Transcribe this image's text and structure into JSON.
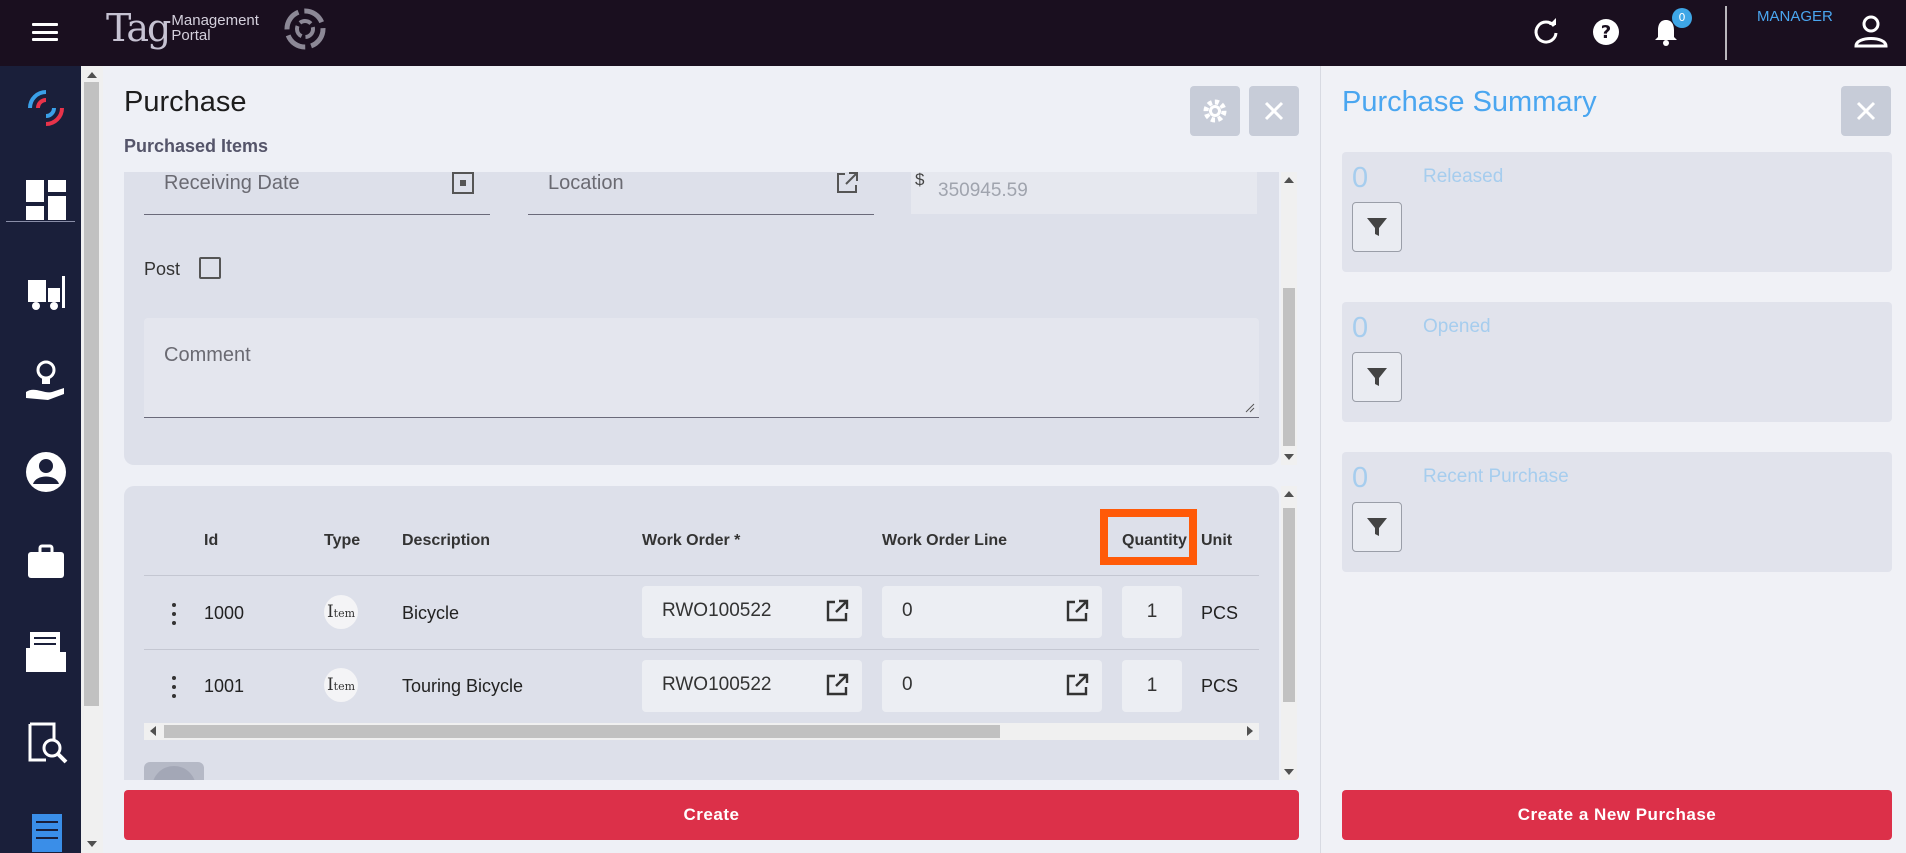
{
  "header": {
    "logo_main": "Tag",
    "logo_line1": "Management",
    "logo_line2": "Portal",
    "notifications_count": "0",
    "role": "MANAGER",
    "icons": [
      "menu-icon",
      "refresh-icon",
      "help-icon",
      "bell-icon",
      "user-icon"
    ]
  },
  "sidebar": {
    "items": [
      {
        "icon": "logo-mark-icon"
      },
      {
        "icon": "dashboard-icon"
      },
      {
        "icon": "forklift-icon"
      },
      {
        "icon": "ideas-icon"
      },
      {
        "icon": "account-icon"
      },
      {
        "icon": "briefcase-icon"
      },
      {
        "icon": "folder-icon"
      },
      {
        "icon": "inspect-icon"
      },
      {
        "icon": "receipt-icon"
      }
    ]
  },
  "main": {
    "title": "Purchase",
    "subtitle": "Purchased Items",
    "form": {
      "receiving_date_label": "Receiving Date",
      "location_label": "Location",
      "currency_symbol": "$",
      "amount": "350945.59",
      "post_label": "Post",
      "post_checked": false,
      "comment_placeholder": "Comment"
    },
    "table": {
      "columns": [
        "Id",
        "Type",
        "Description",
        "Work Order *",
        "Work Order Line",
        "Quantity",
        "Unit"
      ],
      "rows": [
        {
          "id": "1000",
          "type_cap": "I",
          "type_rest": "tem",
          "description": "Bicycle",
          "work_order": "RWO100522",
          "work_order_line": "0",
          "quantity": "1",
          "unit": "PCS"
        },
        {
          "id": "1001",
          "type_cap": "I",
          "type_rest": "tem",
          "description": "Touring Bicycle",
          "work_order": "RWO100522",
          "work_order_line": "0",
          "quantity": "1",
          "unit": "PCS"
        }
      ]
    },
    "create_label": "Create"
  },
  "summary": {
    "title": "Purchase Summary",
    "cards": [
      {
        "count": "0",
        "label": "Released"
      },
      {
        "count": "0",
        "label": "Opened"
      },
      {
        "count": "0",
        "label": "Recent Purchase"
      }
    ],
    "new_purchase_label": "Create a New Purchase"
  },
  "colors": {
    "topbar": "#1a0f1f",
    "sidebar": "#1a1f3a",
    "accent": "#4aa6f0",
    "primary_button": "#dc3049",
    "highlight": "#ff5a08"
  }
}
